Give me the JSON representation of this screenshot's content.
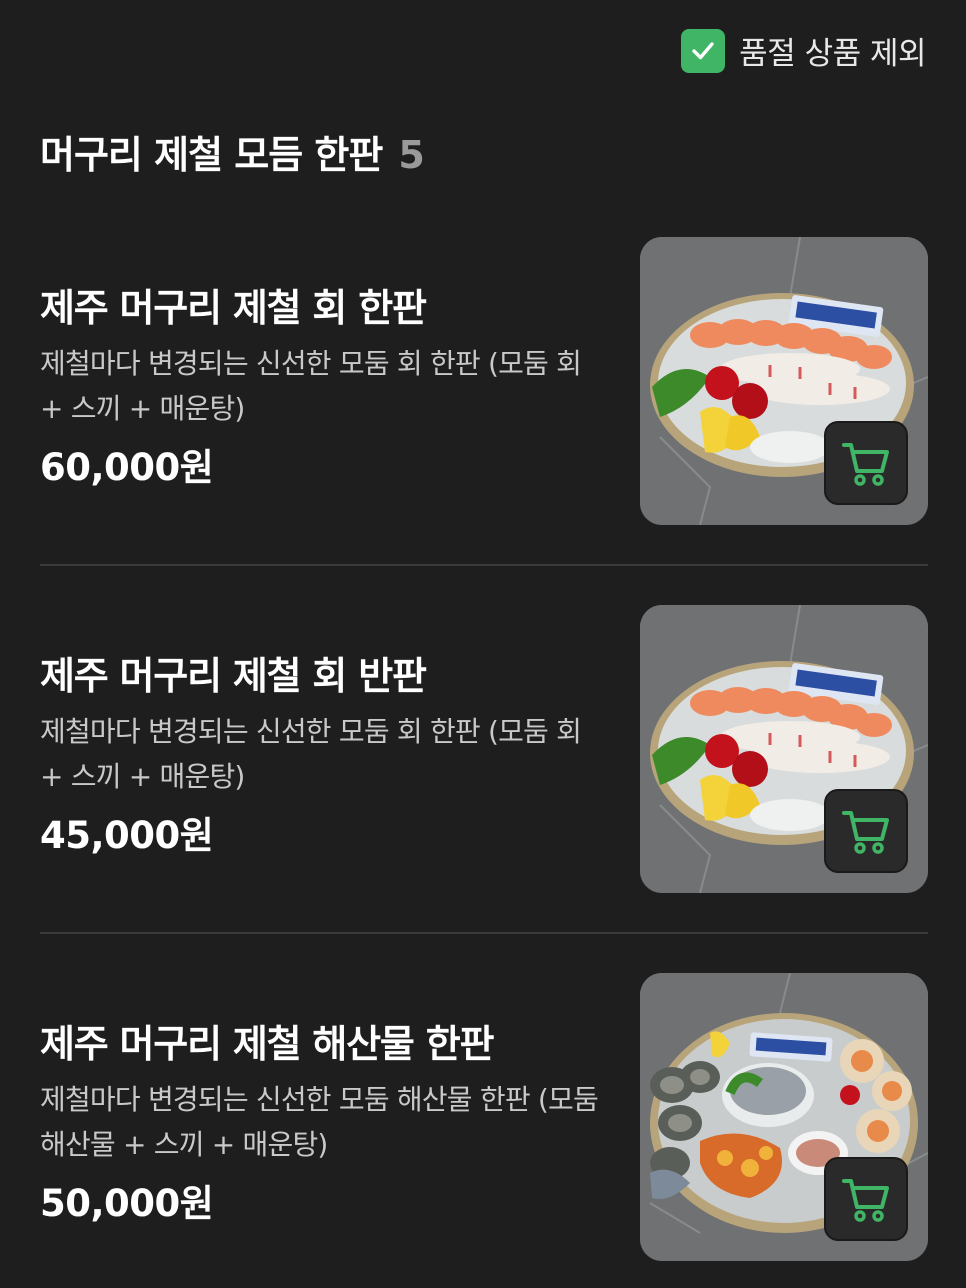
{
  "filter": {
    "label": "품절 상품 제외",
    "checked": true,
    "accent": "#3fb565"
  },
  "section": {
    "title": "머구리 제철 모듬 한판",
    "count": "5"
  },
  "items": [
    {
      "name": "제주 머구리 제철 회 한판",
      "desc": "제철마다 변경되는 신선한 모둠 회 한판 (모둠 회 + 스끼 + 매운탕)",
      "price": "60,000원",
      "image": "sashimi-platter-photo",
      "cart_icon": "cart-icon"
    },
    {
      "name": "제주 머구리 제철 회 반판",
      "desc": "제철마다 변경되는 신선한 모둠 회 한판 (모둠 회 + 스끼 + 매운탕)",
      "price": "45,000원",
      "image": "sashimi-platter-photo",
      "cart_icon": "cart-icon"
    },
    {
      "name": "제주 머구리 제철 해산물 한판",
      "desc": "제철마다 변경되는 신선한 모둠 해산물 한판 (모둠 해산물 + 스끼 + 매운탕)",
      "price": "50,000원",
      "image": "seafood-platter-photo",
      "cart_icon": "cart-icon"
    }
  ]
}
